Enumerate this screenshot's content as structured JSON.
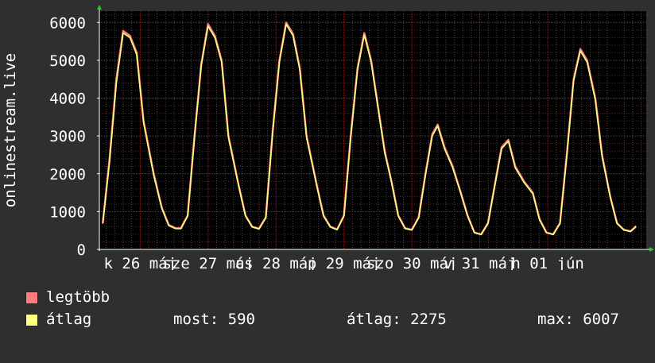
{
  "chart_data": {
    "type": "line",
    "ylabel": "onlinestream.live",
    "ylim": [
      0,
      6300
    ],
    "y_ticks": [
      0,
      1000,
      2000,
      3000,
      4000,
      5000,
      6000
    ],
    "x_ticks": [
      {
        "t": 0.0,
        "label": "k 26 máj"
      },
      {
        "t": 1.0,
        "label": "sze 27 máj"
      },
      {
        "t": 2.0,
        "label": "cs 28 máj"
      },
      {
        "t": 3.0,
        "label": "p 29 máj"
      },
      {
        "t": 4.0,
        "label": "szo 30 máj"
      },
      {
        "t": 5.0,
        "label": "v 31 máj"
      },
      {
        "t": 6.0,
        "label": "h 01 jún"
      }
    ],
    "series": [
      {
        "name": "legtöbb",
        "color": "#ff7f7f",
        "points": [
          [
            -0.55,
            700
          ],
          [
            -0.45,
            2400
          ],
          [
            -0.35,
            4500
          ],
          [
            -0.25,
            5780
          ],
          [
            -0.15,
            5650
          ],
          [
            -0.05,
            5200
          ],
          [
            0.05,
            3400
          ],
          [
            0.2,
            2000
          ],
          [
            0.32,
            1100
          ],
          [
            0.42,
            650
          ],
          [
            0.52,
            560
          ],
          [
            0.6,
            560
          ],
          [
            0.7,
            900
          ],
          [
            0.8,
            3000
          ],
          [
            0.9,
            4900
          ],
          [
            1.0,
            5960
          ],
          [
            1.1,
            5650
          ],
          [
            1.2,
            5000
          ],
          [
            1.3,
            3000
          ],
          [
            1.45,
            1700
          ],
          [
            1.55,
            900
          ],
          [
            1.65,
            600
          ],
          [
            1.75,
            550
          ],
          [
            1.85,
            850
          ],
          [
            1.95,
            3100
          ],
          [
            2.05,
            5000
          ],
          [
            2.15,
            6000
          ],
          [
            2.25,
            5700
          ],
          [
            2.35,
            4800
          ],
          [
            2.45,
            3000
          ],
          [
            2.6,
            1700
          ],
          [
            2.7,
            900
          ],
          [
            2.8,
            600
          ],
          [
            2.9,
            530
          ],
          [
            3.0,
            900
          ],
          [
            3.1,
            3000
          ],
          [
            3.2,
            4800
          ],
          [
            3.3,
            5720
          ],
          [
            3.4,
            5000
          ],
          [
            3.5,
            3800
          ],
          [
            3.6,
            2600
          ],
          [
            3.7,
            1800
          ],
          [
            3.8,
            900
          ],
          [
            3.9,
            560
          ],
          [
            4.0,
            520
          ],
          [
            4.1,
            850
          ],
          [
            4.2,
            2000
          ],
          [
            4.3,
            3050
          ],
          [
            4.38,
            3300
          ],
          [
            4.48,
            2700
          ],
          [
            4.6,
            2200
          ],
          [
            4.72,
            1500
          ],
          [
            4.82,
            900
          ],
          [
            4.92,
            450
          ],
          [
            5.02,
            400
          ],
          [
            5.12,
            700
          ],
          [
            5.22,
            1700
          ],
          [
            5.32,
            2700
          ],
          [
            5.42,
            2900
          ],
          [
            5.52,
            2200
          ],
          [
            5.65,
            1800
          ],
          [
            5.78,
            1500
          ],
          [
            5.88,
            800
          ],
          [
            5.98,
            450
          ],
          [
            6.08,
            400
          ],
          [
            6.18,
            700
          ],
          [
            6.28,
            2500
          ],
          [
            6.38,
            4500
          ],
          [
            6.48,
            5300
          ],
          [
            6.58,
            5000
          ],
          [
            6.7,
            4000
          ],
          [
            6.8,
            2500
          ],
          [
            6.92,
            1400
          ],
          [
            7.02,
            700
          ],
          [
            7.12,
            520
          ],
          [
            7.22,
            480
          ],
          [
            7.3,
            620
          ]
        ]
      },
      {
        "name": "átlag",
        "color": "#ffff80",
        "points": [
          [
            -0.55,
            680
          ],
          [
            -0.45,
            2300
          ],
          [
            -0.35,
            4400
          ],
          [
            -0.25,
            5720
          ],
          [
            -0.15,
            5600
          ],
          [
            -0.05,
            5150
          ],
          [
            0.05,
            3350
          ],
          [
            0.2,
            1950
          ],
          [
            0.32,
            1080
          ],
          [
            0.42,
            630
          ],
          [
            0.52,
            550
          ],
          [
            0.6,
            545
          ],
          [
            0.7,
            880
          ],
          [
            0.8,
            2950
          ],
          [
            0.9,
            4850
          ],
          [
            1.0,
            5900
          ],
          [
            1.1,
            5600
          ],
          [
            1.2,
            4950
          ],
          [
            1.3,
            2950
          ],
          [
            1.45,
            1680
          ],
          [
            1.55,
            880
          ],
          [
            1.65,
            590
          ],
          [
            1.75,
            540
          ],
          [
            1.85,
            830
          ],
          [
            1.95,
            3050
          ],
          [
            2.05,
            4950
          ],
          [
            2.15,
            5950
          ],
          [
            2.25,
            5650
          ],
          [
            2.35,
            4750
          ],
          [
            2.45,
            2950
          ],
          [
            2.6,
            1680
          ],
          [
            2.7,
            880
          ],
          [
            2.8,
            590
          ],
          [
            2.9,
            520
          ],
          [
            3.0,
            880
          ],
          [
            3.1,
            2950
          ],
          [
            3.2,
            4750
          ],
          [
            3.3,
            5670
          ],
          [
            3.4,
            4950
          ],
          [
            3.5,
            3750
          ],
          [
            3.6,
            2550
          ],
          [
            3.7,
            1780
          ],
          [
            3.8,
            880
          ],
          [
            3.9,
            550
          ],
          [
            4.0,
            510
          ],
          [
            4.1,
            830
          ],
          [
            4.2,
            1950
          ],
          [
            4.3,
            3000
          ],
          [
            4.38,
            3260
          ],
          [
            4.48,
            2660
          ],
          [
            4.6,
            2160
          ],
          [
            4.72,
            1480
          ],
          [
            4.82,
            880
          ],
          [
            4.92,
            440
          ],
          [
            5.02,
            390
          ],
          [
            5.12,
            680
          ],
          [
            5.22,
            1670
          ],
          [
            5.32,
            2660
          ],
          [
            5.42,
            2860
          ],
          [
            5.52,
            2160
          ],
          [
            5.65,
            1770
          ],
          [
            5.78,
            1470
          ],
          [
            5.88,
            780
          ],
          [
            5.98,
            440
          ],
          [
            6.08,
            390
          ],
          [
            6.18,
            680
          ],
          [
            6.28,
            2450
          ],
          [
            6.38,
            4450
          ],
          [
            6.48,
            5250
          ],
          [
            6.58,
            4950
          ],
          [
            6.7,
            3950
          ],
          [
            6.8,
            2450
          ],
          [
            6.92,
            1380
          ],
          [
            7.02,
            680
          ],
          [
            7.12,
            510
          ],
          [
            7.22,
            470
          ],
          [
            7.3,
            600
          ]
        ]
      }
    ]
  },
  "legend": {
    "max_label": "legtöbb",
    "avg_label": "átlag",
    "max_color": "#ff7f7f",
    "avg_color": "#ffff80"
  },
  "stats": {
    "now": "most: 590",
    "avg": "átlag: 2275",
    "max": "max: 6007"
  }
}
